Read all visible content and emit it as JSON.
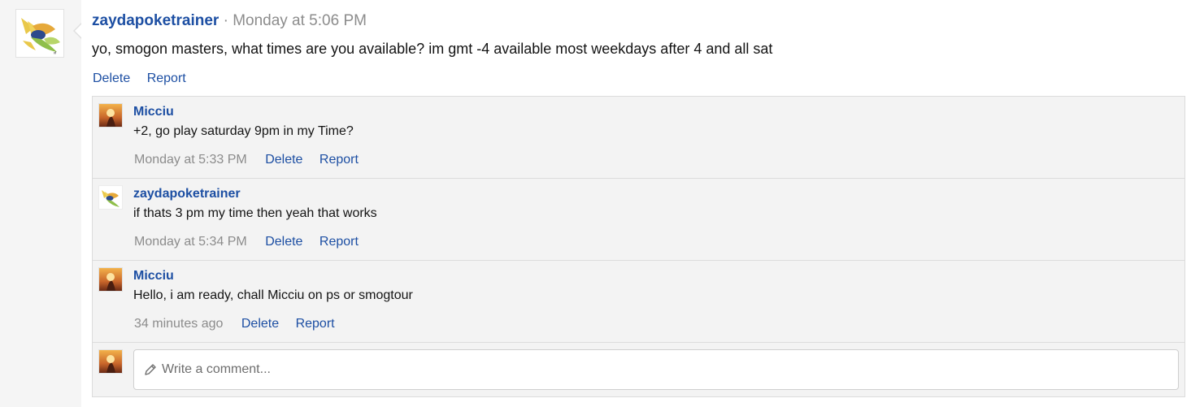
{
  "post": {
    "author": "zaydapoketrainer",
    "separator": "·",
    "time": "Monday at 5:06 PM",
    "text": "yo, smogon masters, what times are you available? im gmt -4 available most weekdays after 4 and all sat",
    "actions": {
      "delete": "Delete",
      "report": "Report"
    }
  },
  "comments": [
    {
      "author": "Micciu",
      "text": "+2, go play saturday 9pm in my Time?",
      "time": "Monday at 5:33 PM",
      "delete": "Delete",
      "report": "Report",
      "avatar": "user-avatar-sunset"
    },
    {
      "author": "zaydapoketrainer",
      "text": "if thats 3 pm my time then yeah that works",
      "time": "Monday at 5:34 PM",
      "delete": "Delete",
      "report": "Report",
      "avatar": "user-avatar-pokemon"
    },
    {
      "author": "Micciu",
      "text": "Hello, i am ready, chall Micciu on ps or smogtour",
      "time": "34 minutes ago",
      "delete": "Delete",
      "report": "Report",
      "avatar": "user-avatar-sunset"
    }
  ],
  "composer": {
    "placeholder": "Write a comment...",
    "icon": "pencil-icon"
  },
  "colors": {
    "link": "#1d4fa3",
    "muted": "#8c8c8c",
    "panel": "#f3f3f3",
    "border": "#dcdcdc"
  }
}
